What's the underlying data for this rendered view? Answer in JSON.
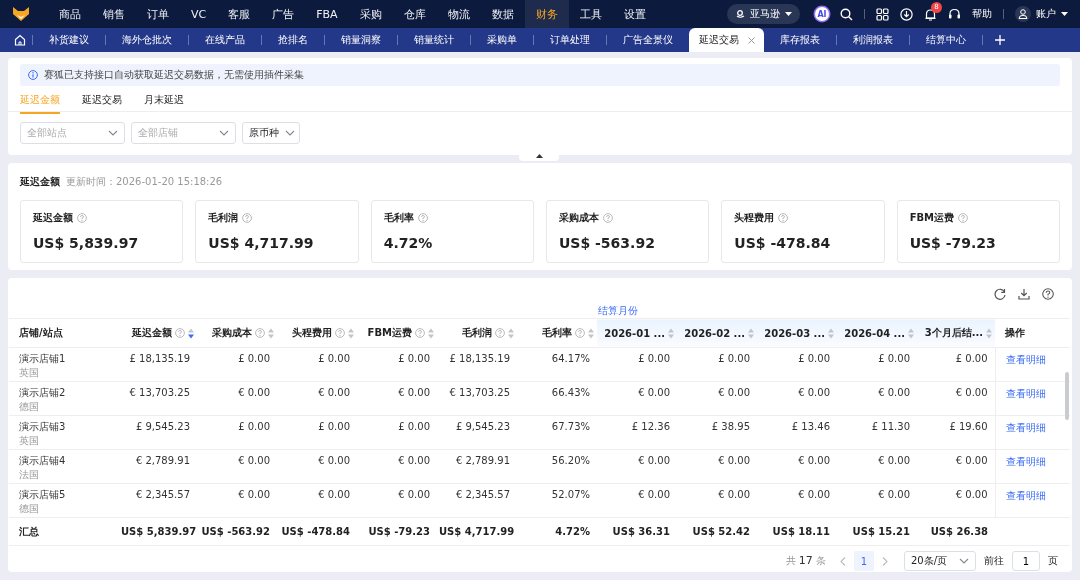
{
  "top_nav": {
    "items": [
      {
        "label": "商品",
        "selected": false
      },
      {
        "label": "销售",
        "selected": false
      },
      {
        "label": "订单",
        "selected": false
      },
      {
        "label": "VC",
        "selected": false
      },
      {
        "label": "客服",
        "selected": false
      },
      {
        "label": "广告",
        "selected": false
      },
      {
        "label": "FBA",
        "selected": false
      },
      {
        "label": "采购",
        "selected": false
      },
      {
        "label": "仓库",
        "selected": false
      },
      {
        "label": "物流",
        "selected": false
      },
      {
        "label": "数据",
        "selected": false
      },
      {
        "label": "财务",
        "selected": true
      },
      {
        "label": "工具",
        "selected": false
      },
      {
        "label": "设置",
        "selected": false
      }
    ],
    "platform": "亚马逊",
    "ai": "AI",
    "notifications": "8",
    "help": "帮助",
    "account": "账户"
  },
  "page_tabs": [
    {
      "label": "补货建议",
      "selected": false
    },
    {
      "label": "海外仓批次",
      "selected": false
    },
    {
      "label": "在线产品",
      "selected": false
    },
    {
      "label": "抢排名",
      "selected": false
    },
    {
      "label": "销量洞察",
      "selected": false
    },
    {
      "label": "销量统计",
      "selected": false
    },
    {
      "label": "采购单",
      "selected": false
    },
    {
      "label": "订单处理",
      "selected": false
    },
    {
      "label": "广告全景仪",
      "selected": false
    },
    {
      "label": "延迟交易",
      "selected": true
    },
    {
      "label": "库存报表",
      "selected": false
    },
    {
      "label": "利润报表",
      "selected": false
    },
    {
      "label": "结算中心",
      "selected": false
    }
  ],
  "notice": "赛狐已支持接口自动获取延迟交易数据，无需使用插件采集",
  "sub_tabs": [
    {
      "label": "延迟金额",
      "selected": true
    },
    {
      "label": "延迟交易",
      "selected": false
    },
    {
      "label": "月末延迟",
      "selected": false
    }
  ],
  "filters": [
    {
      "placeholder": "全部站点"
    },
    {
      "placeholder": "全部店铺"
    },
    {
      "value": "原币种"
    }
  ],
  "summary": {
    "title": "延迟金额",
    "updated": "更新时间：2026-01-20 15:18:26",
    "cards": [
      {
        "label": "延迟金额",
        "value": "US$ 5,839.97"
      },
      {
        "label": "毛利润",
        "value": "US$ 4,717.99"
      },
      {
        "label": "毛利率",
        "value": "4.72%"
      },
      {
        "label": "采购成本",
        "value": "US$ -563.92"
      },
      {
        "label": "头程费用",
        "value": "US$ -478.84"
      },
      {
        "label": "FBM运费",
        "value": "US$ -79.23"
      }
    ]
  },
  "table": {
    "group_header": "结算月份",
    "columns": [
      {
        "label": "店铺/站点",
        "help": false,
        "group": false
      },
      {
        "label": "延迟金额",
        "help": true,
        "sort_descending": true,
        "group": false
      },
      {
        "label": "采购成本",
        "help": true,
        "sort_descending": false,
        "group": false
      },
      {
        "label": "头程费用",
        "help": true,
        "sort_descending": false,
        "group": false
      },
      {
        "label": "FBM运费",
        "help": true,
        "sort_descending": false,
        "group": false
      },
      {
        "label": "毛利润",
        "help": true,
        "sort_descending": false,
        "group": false
      },
      {
        "label": "毛利率",
        "help": true,
        "sort_descending": false,
        "group": false
      },
      {
        "label": "2026-01 ...",
        "help": false,
        "sort_descending": false,
        "group": true
      },
      {
        "label": "2026-02 ...",
        "help": false,
        "sort_descending": false,
        "group": true
      },
      {
        "label": "2026-03 ...",
        "help": false,
        "sort_descending": false,
        "group": true
      },
      {
        "label": "2026-04 ...",
        "help": false,
        "sort_descending": false,
        "group": true
      },
      {
        "label": "3个月后结...",
        "help": false,
        "sort_descending": false,
        "group": true
      },
      {
        "label": "操作",
        "help": false,
        "group": false
      }
    ],
    "rows": [
      {
        "cells": [
          {
            "store": "演示店铺1",
            "site": "英国"
          },
          "£ 18,135.19",
          "£ 0.00",
          "£ 0.00",
          "£ 0.00",
          "£ 18,135.19",
          "64.17%",
          "£ 0.00",
          "£ 0.00",
          "£ 0.00",
          "£ 0.00",
          "£ 0.00",
          "查看明细"
        ]
      },
      {
        "cells": [
          {
            "store": "演示店铺2",
            "site": "德国"
          },
          "€ 13,703.25",
          "€ 0.00",
          "€ 0.00",
          "€ 0.00",
          "€ 13,703.25",
          "66.43%",
          "€ 0.00",
          "€ 0.00",
          "€ 0.00",
          "€ 0.00",
          "€ 0.00",
          "查看明细"
        ]
      },
      {
        "cells": [
          {
            "store": "演示店铺3",
            "site": "英国"
          },
          "£ 9,545.23",
          "£ 0.00",
          "£ 0.00",
          "£ 0.00",
          "£ 9,545.23",
          "67.73%",
          "£ 12.36",
          "£ 38.95",
          "£ 13.46",
          "£ 11.30",
          "£ 19.60",
          "查看明细"
        ]
      },
      {
        "cells": [
          {
            "store": "演示店铺4",
            "site": "法国"
          },
          "€ 2,789.91",
          "€ 0.00",
          "€ 0.00",
          "€ 0.00",
          "€ 2,789.91",
          "56.20%",
          "€ 0.00",
          "€ 0.00",
          "€ 0.00",
          "€ 0.00",
          "€ 0.00",
          "查看明细"
        ]
      },
      {
        "cells": [
          {
            "store": "演示店铺5",
            "site": "德国"
          },
          "€ 2,345.57",
          "€ 0.00",
          "€ 0.00",
          "€ 0.00",
          "€ 2,345.57",
          "52.07%",
          "€ 0.00",
          "€ 0.00",
          "€ 0.00",
          "€ 0.00",
          "€ 0.00",
          "查看明细"
        ]
      },
      {
        "kind": "total",
        "cells": [
          "汇总",
          "US$ 5,839.97",
          "US$ -563.92",
          "US$ -478.84",
          "US$ -79.23",
          "US$ 4,717.99",
          "4.72%",
          "US$ 36.31",
          "US$ 52.42",
          "US$ 18.11",
          "US$ 15.21",
          "US$ 26.38"
        ]
      }
    ]
  },
  "pagination": {
    "total": "共 **17** 条",
    "pages": [
      {
        "label": "1",
        "selected": true
      }
    ],
    "page_size": "20条/页",
    "goto_label": "前往",
    "goto_value": "1",
    "page_unit": "页"
  }
}
